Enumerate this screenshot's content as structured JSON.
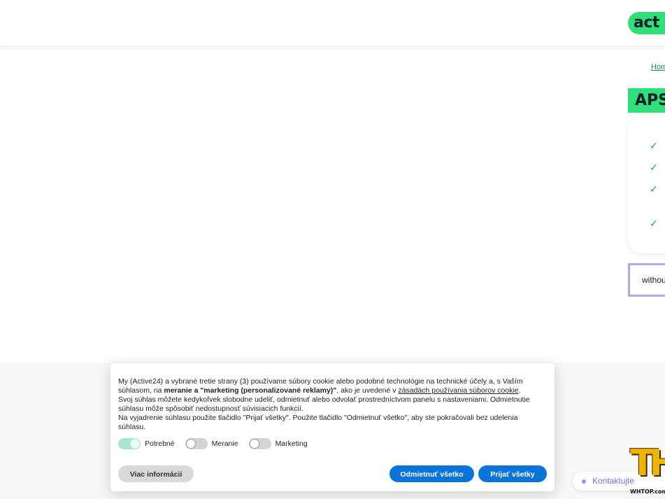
{
  "header": {
    "logo_text": "act"
  },
  "breadcrumb": {
    "home_label": "Hom"
  },
  "banner": {
    "title": "APS"
  },
  "features": {
    "check_glyph": "✓",
    "count": 4
  },
  "without_box": {
    "text": "withou"
  },
  "cookie": {
    "p1_a": "My (Active24) a vybrané tretie strany (3) používame súbory cookie alebo podobné technológie na technické účely a, s Vaším súhlasom, na ",
    "p1_bold": "meranie a \"marketing (personalizované reklamy)\"",
    "p1_b": ", ako je uvedené v ",
    "p1_link": "zásadách používania súborov cookie",
    "p1_c": ".",
    "p2": "Svoj súhlas môžete kedykoľvek slobodne udeliť, odmietnuť alebo odvolať prostredníctvom panelu s nastaveniami. Odmietnutie súhlasu môže spôsobiť nedostupnosť súvisiacich funkcií.",
    "p3": "Na vyjadrenie súhlasu použite tlačidlo \"Prijať všetky\". Použite tlačidlo \"Odmietnuť všetko\", aby ste pokračovali bez udelenia súhlasu.",
    "toggles": [
      {
        "label": "Potrebné",
        "on": true
      },
      {
        "label": "Meranie",
        "on": false
      },
      {
        "label": "Marketing",
        "on": false
      }
    ],
    "more_label": "Viac informácií",
    "decline_label": "Odmietnuť všetko",
    "accept_label": "Prijať všetky"
  },
  "contact": {
    "label": "Kontaktujte"
  },
  "watermark": {
    "big": "TH",
    "small": "WHTOP.com"
  },
  "colors": {
    "brand_green": "#2fe07a",
    "button_blue": "#0b74d9",
    "purple": "#b6a6ef"
  }
}
